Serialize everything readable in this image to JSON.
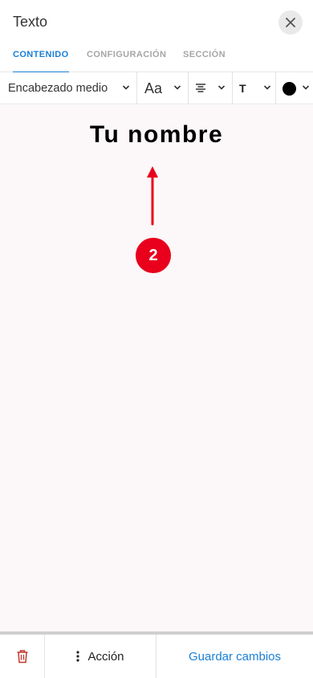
{
  "header": {
    "title": "Texto",
    "close_icon": "close-icon"
  },
  "tabs": [
    {
      "label": "CONTENIDO",
      "active": true
    },
    {
      "label": "CONFIGURACIÓN",
      "active": false
    },
    {
      "label": "SECCIÓN",
      "active": false
    }
  ],
  "toolbar": {
    "heading_select": "Encabezado medio",
    "font_size_label": "Aa",
    "align_icon": "align-center-icon",
    "text_transform_label": "T",
    "text_color": "#000000"
  },
  "canvas": {
    "heading_text": "Tu nombre",
    "step_number": "2",
    "badge_color": "#e8001c"
  },
  "footer": {
    "delete_icon": "trash-icon",
    "action_label": "Acción",
    "save_label": "Guardar cambios"
  },
  "colors": {
    "accent": "#1a7fd6",
    "canvas_bg": "#fcf7f8",
    "danger": "#c0392b"
  }
}
